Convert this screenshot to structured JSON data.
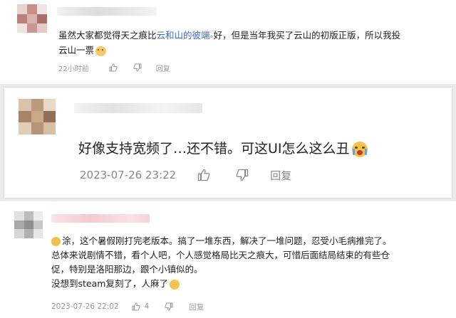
{
  "comments": [
    {
      "text_segments": [
        {
          "text": "虽然大家都觉得天之痕比",
          "style": "normal"
        },
        {
          "text": "云和山的彼端",
          "style": "link"
        },
        {
          "text": "好，但是当年我买了云山的初版正版，所以我投",
          "style": "normal"
        }
      ],
      "text_line2": "云山一票",
      "time": "22小时前",
      "reply_label": "回复",
      "reaction_icon": "smile-cat-emoji"
    },
    {
      "text": "好像支持宽频了…还不错。可这UI怎么这么丑",
      "time": "2023-07-26 23:22",
      "reply_label": "回复",
      "reaction_icon": "crying-emoji"
    },
    {
      "lines": [
        "涂，这个暑假刚打完老版本。搞了一堆东西，解决了一堆问题，忍受小毛病推完了。",
        "总体来说剧情不错，看个人吧，个人感觉格局比天之痕大，可惜后面结局结束的有些仓",
        "促，特别是洛阳那边，跟个小镇似的。",
        "没想到steam复刻了，人麻了"
      ],
      "time": "2023-07-26 22:02",
      "like_count": "4",
      "reply_label": "回复"
    }
  ],
  "colors": {
    "link": "#3d6cc8",
    "meta": "#999999",
    "background": "#ececec"
  }
}
